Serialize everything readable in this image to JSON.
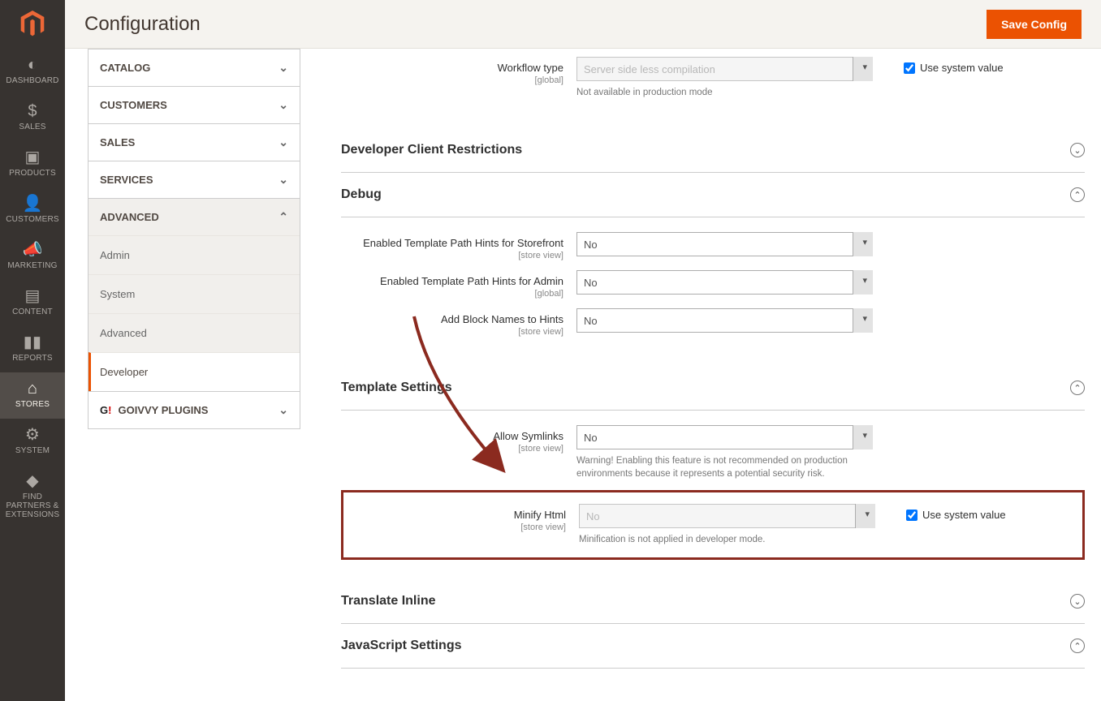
{
  "header": {
    "title": "Configuration",
    "save_btn": "Save Config"
  },
  "icon_nav": [
    {
      "key": "dashboard",
      "label": "DASHBOARD"
    },
    {
      "key": "sales",
      "label": "SALES"
    },
    {
      "key": "products",
      "label": "PRODUCTS"
    },
    {
      "key": "customers",
      "label": "CUSTOMERS"
    },
    {
      "key": "marketing",
      "label": "MARKETING"
    },
    {
      "key": "content",
      "label": "CONTENT"
    },
    {
      "key": "reports",
      "label": "REPORTS"
    },
    {
      "key": "stores",
      "label": "STORES"
    },
    {
      "key": "system",
      "label": "SYSTEM"
    },
    {
      "key": "partners",
      "label": "FIND PARTNERS & EXTENSIONS"
    }
  ],
  "conf_tabs": {
    "catalog": "CATALOG",
    "customers": "CUSTOMERS",
    "sales": "SALES",
    "services": "SERVICES",
    "advanced": "ADVANCED",
    "plugins": "GOIVVY PLUGINS"
  },
  "advanced_sub": {
    "admin": "Admin",
    "system": "System",
    "advanced": "Advanced",
    "developer": "Developer"
  },
  "workflow": {
    "label": "Workflow type",
    "scope": "[global]",
    "value": "Server side less compilation",
    "note": "Not available in production mode"
  },
  "sections": {
    "client_restrictions": "Developer Client Restrictions",
    "debug": "Debug",
    "template": "Template Settings",
    "translate": "Translate Inline",
    "js": "JavaScript Settings"
  },
  "debug": {
    "storefront": {
      "label": "Enabled Template Path Hints for Storefront",
      "scope": "[store view]",
      "value": "No"
    },
    "admin": {
      "label": "Enabled Template Path Hints for Admin",
      "scope": "[global]",
      "value": "No"
    },
    "block": {
      "label": "Add Block Names to Hints",
      "scope": "[store view]",
      "value": "No"
    }
  },
  "template": {
    "symlinks": {
      "label": "Allow Symlinks",
      "scope": "[store view]",
      "value": "No",
      "note": "Warning! Enabling this feature is not recommended on production environments because it represents a potential security risk."
    },
    "minify": {
      "label": "Minify Html",
      "scope": "[store view]",
      "value": "No",
      "note": "Minification is not applied in developer mode."
    }
  },
  "use_system_value": "Use system value"
}
